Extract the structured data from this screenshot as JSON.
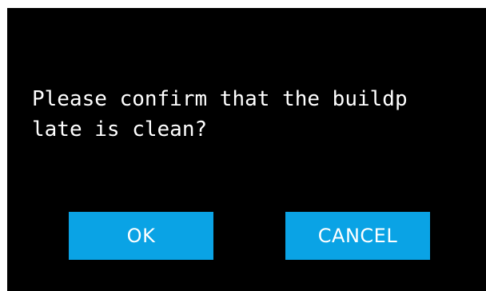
{
  "dialog": {
    "message": "Please confirm that the buildp\nlate is clean?",
    "ok_label": "OK",
    "cancel_label": "CANCEL"
  },
  "colors": {
    "background": "#000000",
    "text": "#ffffff",
    "button": "#0aa3e5"
  }
}
